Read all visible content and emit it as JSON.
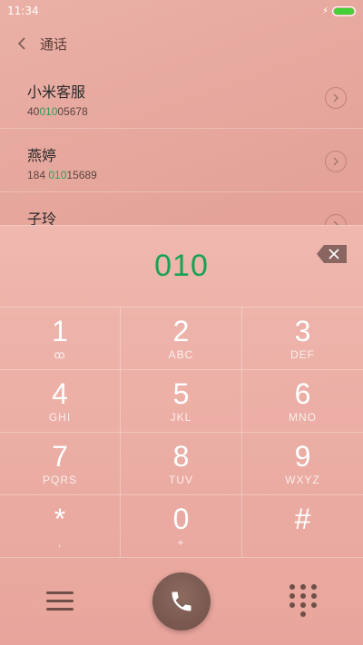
{
  "status_bar": {
    "time": "11:34"
  },
  "header": {
    "title": "通话"
  },
  "contacts": [
    {
      "name": "小米客服",
      "number_pre": "40",
      "number_hl": "010",
      "number_post": "05678"
    },
    {
      "name": "燕婷",
      "number_pre": "184 ",
      "number_hl": "010",
      "number_post": "15689"
    },
    {
      "name": "子玲",
      "number_pre": "",
      "number_hl": "",
      "number_post": ""
    }
  ],
  "dialer": {
    "input": "010"
  },
  "keypad": [
    {
      "digit": "1",
      "letters": "ꝏ"
    },
    {
      "digit": "2",
      "letters": "ABC"
    },
    {
      "digit": "3",
      "letters": "DEF"
    },
    {
      "digit": "4",
      "letters": "GHI"
    },
    {
      "digit": "5",
      "letters": "JKL"
    },
    {
      "digit": "6",
      "letters": "MNO"
    },
    {
      "digit": "7",
      "letters": "PQRS"
    },
    {
      "digit": "8",
      "letters": "TUV"
    },
    {
      "digit": "9",
      "letters": "WXYZ"
    },
    {
      "digit": "*",
      "letters": ","
    },
    {
      "digit": "0",
      "letters": "+"
    },
    {
      "digit": "#",
      "letters": ""
    }
  ],
  "colors": {
    "highlight": "#17a255",
    "accent_call": "#7a5a51"
  }
}
